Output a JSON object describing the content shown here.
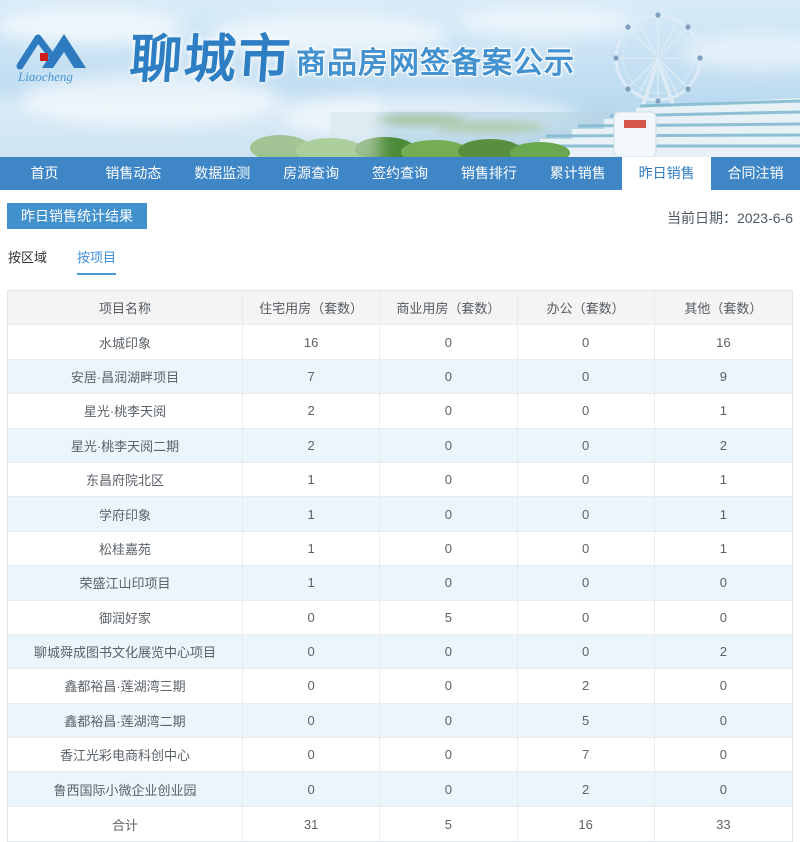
{
  "header": {
    "logo_script": "Liaocheng",
    "calligraphy": "聊城市",
    "title": "商品房网签备案公示"
  },
  "nav": {
    "items": [
      {
        "label": "首页",
        "active": false
      },
      {
        "label": "销售动态",
        "active": false
      },
      {
        "label": "数据监测",
        "active": false
      },
      {
        "label": "房源查询",
        "active": false
      },
      {
        "label": "签约查询",
        "active": false
      },
      {
        "label": "销售排行",
        "active": false
      },
      {
        "label": "累计销售",
        "active": false
      },
      {
        "label": "昨日销售",
        "active": true
      },
      {
        "label": "合同注销",
        "active": false
      }
    ]
  },
  "page": {
    "section_title": "昨日销售统计结果",
    "date_label": "当前日期：",
    "date_value": "2023-6-6",
    "subtabs": [
      {
        "label": "按区域",
        "active": false
      },
      {
        "label": "按项目",
        "active": true
      }
    ]
  },
  "table": {
    "headers": [
      "项目名称",
      "住宅用房（套数）",
      "商业用房（套数）",
      "办公（套数）",
      "其他（套数）"
    ],
    "rows": [
      [
        "水城印象",
        "16",
        "0",
        "0",
        "16"
      ],
      [
        "安居·昌润湖畔项目",
        "7",
        "0",
        "0",
        "9"
      ],
      [
        "星光·桃李天阅",
        "2",
        "0",
        "0",
        "1"
      ],
      [
        "星光·桃李天阅二期",
        "2",
        "0",
        "0",
        "2"
      ],
      [
        "东昌府院北区",
        "1",
        "0",
        "0",
        "1"
      ],
      [
        "学府印象",
        "1",
        "0",
        "0",
        "1"
      ],
      [
        "松桂嘉苑",
        "1",
        "0",
        "0",
        "1"
      ],
      [
        "荣盛江山印项目",
        "1",
        "0",
        "0",
        "0"
      ],
      [
        "御润好家",
        "0",
        "5",
        "0",
        "0"
      ],
      [
        "聊城舜成图书文化展览中心项目",
        "0",
        "0",
        "0",
        "2"
      ],
      [
        "鑫都裕昌·莲湖湾三期",
        "0",
        "0",
        "2",
        "0"
      ],
      [
        "鑫都裕昌·莲湖湾二期",
        "0",
        "0",
        "5",
        "0"
      ],
      [
        "香江光彩电商科创中心",
        "0",
        "0",
        "7",
        "0"
      ],
      [
        "鲁西国际小微企业创业园",
        "0",
        "0",
        "2",
        "0"
      ]
    ],
    "total_row": [
      "合计",
      "31",
      "5",
      "16",
      "33"
    ]
  },
  "colors": {
    "nav_blue": "#3e86c5",
    "accent_blue": "#3e90d8",
    "section_title_bg": "#4191cd",
    "alt_row_bg": "#ebf5fc",
    "header_row_bg": "#f4f4f4",
    "logo_red": "#cf1f1f"
  }
}
